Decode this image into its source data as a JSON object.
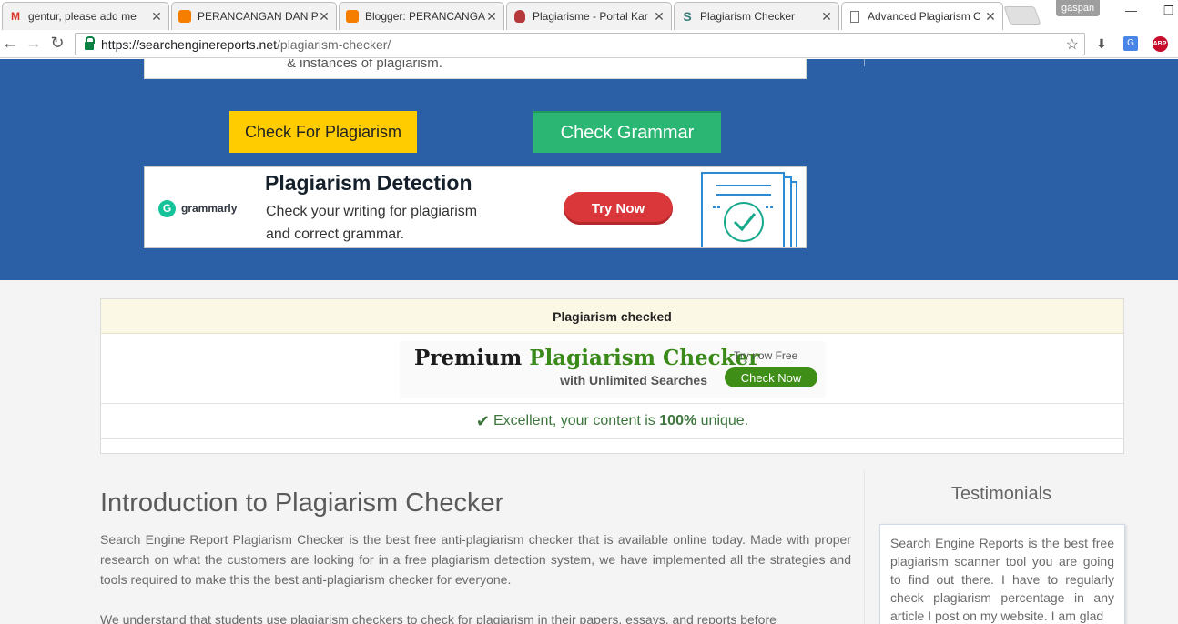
{
  "browser": {
    "tabs": [
      {
        "title": "gentur, please add me",
        "icon": "gmail-icon"
      },
      {
        "title": "PERANCANGAN DAN PE",
        "icon": "blogger-icon"
      },
      {
        "title": "Blogger: PERANCANGA",
        "icon": "blogger-icon"
      },
      {
        "title": "Plagiarisme - Portal Kar",
        "icon": "portal-icon"
      },
      {
        "title": "Plagiarism Checker",
        "icon": "smallseotools-icon"
      },
      {
        "title": "Advanced Plagiarism C",
        "icon": "page-icon"
      }
    ],
    "user_badge": "gaspan",
    "url_host": "https://searchenginereports.net",
    "url_path": "/plagiarism-checker/"
  },
  "hero": {
    "cut_text": "& instances of plagiarism.",
    "check_button": "Check For Plagiarism",
    "grammar_button": "Check Grammar"
  },
  "ad": {
    "brand": "grammarly",
    "heading": "Plagiarism Detection",
    "line1": "Check your writing for plagiarism",
    "line2": "and correct grammar.",
    "button": "Try Now"
  },
  "results": {
    "header": "Plagiarism checked",
    "promo_word1": "Premium",
    "promo_word2": "Plagiarism Checker",
    "promo_sub": "with Unlimited Searches",
    "promo_try": "Try now Free",
    "promo_button": "Check Now",
    "status_prefix": "Excellent, your content is",
    "status_value": "100%",
    "status_suffix": "unique."
  },
  "intro": {
    "title": "Introduction to Plagiarism Checker",
    "p1": "Search Engine Report Plagiarism Checker is the best free anti-plagiarism checker that is available online today. Made with proper research on what the customers are looking for in a free plagiarism detection system, we have implemented all the strategies and tools required to make this the best anti-plagiarism checker for everyone.",
    "p2": "We understand that students use plagiarism checkers to check for plagiarism in their papers, essays, and reports before"
  },
  "testimonials": {
    "title": "Testimonials",
    "text": "Search Engine Reports is the best free plagiarism scanner tool you are going to find out there. I have to regularly check plagiarism percentage in any article I post on my website. I am glad"
  },
  "colors": {
    "hero_bg": "#2b5fa6",
    "check_btn": "#ffcc00",
    "grammar_btn": "#2bb673",
    "success": "#3c763d"
  }
}
